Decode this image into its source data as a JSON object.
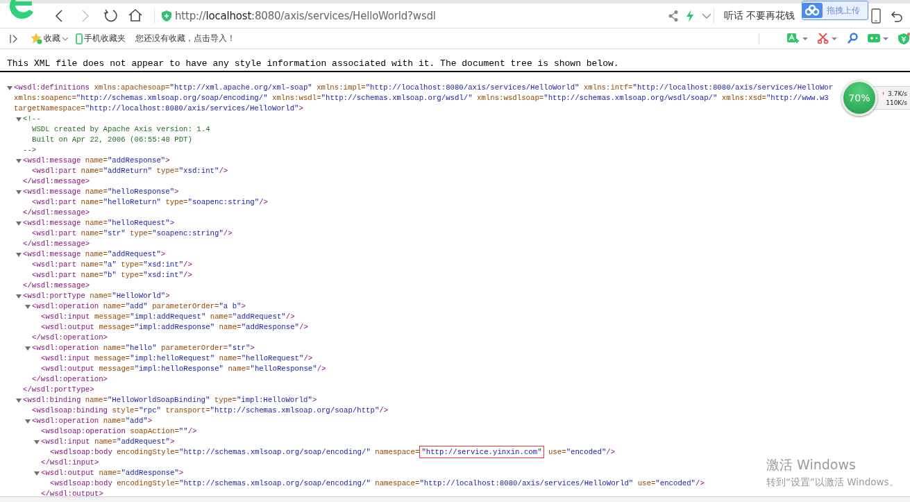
{
  "browser": {
    "nav_buttons": [
      {
        "kind": "back",
        "disabled": false
      },
      {
        "kind": "forward",
        "disabled": true
      },
      {
        "kind": "reload",
        "disabled": false
      },
      {
        "kind": "home",
        "disabled": false
      }
    ],
    "address": {
      "scheme": "http://",
      "host": "localhost",
      "path": ":8080/axis/services/HelloWorld?wsdl"
    },
    "search_text": "听话 不要再花钱",
    "upload_button": "拖拽上传"
  },
  "bookmarks_bar": {
    "favorites": "收藏",
    "mobile_favorites": "手机收藏夹",
    "hint": "您还没有收藏，点击导入！"
  },
  "xml_viewer": {
    "notice": "This XML file does not appear to have any style information associated with it. The document tree is shown below.",
    "tree": [
      {
        "expanded": true,
        "open": [
          [
            {
              "kind": "tag",
              "text": "<wsdl:definitions"
            },
            {
              "kind": "attr",
              "text": " xmlns:apachesoap="
            },
            {
              "kind": "value",
              "text": "\"http://xml.apache.org/xml-soap\""
            },
            {
              "kind": "attr",
              "text": " xmlns:impl="
            },
            {
              "kind": "value",
              "text": "\"http://localhost:8080/axis/services/HelloWorld\""
            },
            {
              "kind": "attr",
              "text": " xmlns:intf="
            },
            {
              "kind": "value",
              "text": "\"http://localhost:8080/axis/services/HelloWor"
            }
          ],
          [
            {
              "kind": "attr",
              "text": "xmlns:soapenc="
            },
            {
              "kind": "value",
              "text": "\"http://schemas.xmlsoap.org/soap/encoding/\""
            },
            {
              "kind": "attr",
              "text": " xmlns:wsdl="
            },
            {
              "kind": "value",
              "text": "\"http://schemas.xmlsoap.org/wsdl/\""
            },
            {
              "kind": "attr",
              "text": " xmlns:wsdlsoap="
            },
            {
              "kind": "value",
              "text": "\"http://schemas.xmlsoap.org/wsdl/soap/\""
            },
            {
              "kind": "attr",
              "text": " xmlns:xsd="
            },
            {
              "kind": "value",
              "text": "\"http://www.w3"
            }
          ],
          [
            {
              "kind": "attr",
              "text": "targetNamespace="
            },
            {
              "kind": "value",
              "text": "\"http://localhost:8080/axis/services/HelloWorld\""
            },
            {
              "kind": "tag",
              "text": ">"
            }
          ]
        ],
        "children": [
          {
            "expanded": true,
            "open": [
              [
                {
                  "kind": "comment",
                  "text": "<!--"
                }
              ]
            ],
            "children": [
              {
                "line": [
                  {
                    "kind": "comment",
                    "text": "WSDL created by Apache Axis version: 1.4"
                  }
                ]
              },
              {
                "line": [
                  {
                    "kind": "comment",
                    "text": "Built on Apr 22, 2006 (06:55:48 PDT)"
                  }
                ]
              }
            ],
            "close": [
              {
                "kind": "comment",
                "text": "-->"
              }
            ]
          },
          {
            "expanded": true,
            "open": [
              [
                {
                  "kind": "tag",
                  "text": "<wsdl:message"
                },
                {
                  "kind": "attr",
                  "text": " name="
                },
                {
                  "kind": "value",
                  "text": "\"addResponse\""
                },
                {
                  "kind": "tag",
                  "text": ">"
                }
              ]
            ],
            "children": [
              {
                "line": [
                  {
                    "kind": "tag",
                    "text": "<wsdl:part"
                  },
                  {
                    "kind": "attr",
                    "text": " name="
                  },
                  {
                    "kind": "value",
                    "text": "\"addReturn\""
                  },
                  {
                    "kind": "attr",
                    "text": " type="
                  },
                  {
                    "kind": "value",
                    "text": "\"xsd:int\""
                  },
                  {
                    "kind": "tag",
                    "text": "/>"
                  }
                ]
              }
            ],
            "close": [
              {
                "kind": "tag",
                "text": "</wsdl:message>"
              }
            ]
          },
          {
            "expanded": true,
            "open": [
              [
                {
                  "kind": "tag",
                  "text": "<wsdl:message"
                },
                {
                  "kind": "attr",
                  "text": " name="
                },
                {
                  "kind": "value",
                  "text": "\"helloResponse\""
                },
                {
                  "kind": "tag",
                  "text": ">"
                }
              ]
            ],
            "children": [
              {
                "line": [
                  {
                    "kind": "tag",
                    "text": "<wsdl:part"
                  },
                  {
                    "kind": "attr",
                    "text": " name="
                  },
                  {
                    "kind": "value",
                    "text": "\"helloReturn\""
                  },
                  {
                    "kind": "attr",
                    "text": " type="
                  },
                  {
                    "kind": "value",
                    "text": "\"soapenc:string\""
                  },
                  {
                    "kind": "tag",
                    "text": "/>"
                  }
                ]
              }
            ],
            "close": [
              {
                "kind": "tag",
                "text": "</wsdl:message>"
              }
            ]
          },
          {
            "expanded": true,
            "open": [
              [
                {
                  "kind": "tag",
                  "text": "<wsdl:message"
                },
                {
                  "kind": "attr",
                  "text": " name="
                },
                {
                  "kind": "value",
                  "text": "\"helloRequest\""
                },
                {
                  "kind": "tag",
                  "text": ">"
                }
              ]
            ],
            "children": [
              {
                "line": [
                  {
                    "kind": "tag",
                    "text": "<wsdl:part"
                  },
                  {
                    "kind": "attr",
                    "text": " name="
                  },
                  {
                    "kind": "value",
                    "text": "\"str\""
                  },
                  {
                    "kind": "attr",
                    "text": " type="
                  },
                  {
                    "kind": "value",
                    "text": "\"soapenc:string\""
                  },
                  {
                    "kind": "tag",
                    "text": "/>"
                  }
                ]
              }
            ],
            "close": [
              {
                "kind": "tag",
                "text": "</wsdl:message>"
              }
            ]
          },
          {
            "expanded": true,
            "open": [
              [
                {
                  "kind": "tag",
                  "text": "<wsdl:message"
                },
                {
                  "kind": "attr",
                  "text": " name="
                },
                {
                  "kind": "value",
                  "text": "\"addRequest\""
                },
                {
                  "kind": "tag",
                  "text": ">"
                }
              ]
            ],
            "children": [
              {
                "line": [
                  {
                    "kind": "tag",
                    "text": "<wsdl:part"
                  },
                  {
                    "kind": "attr",
                    "text": " name="
                  },
                  {
                    "kind": "value",
                    "text": "\"a\""
                  },
                  {
                    "kind": "attr",
                    "text": " type="
                  },
                  {
                    "kind": "value",
                    "text": "\"xsd:int\""
                  },
                  {
                    "kind": "tag",
                    "text": "/>"
                  }
                ]
              },
              {
                "line": [
                  {
                    "kind": "tag",
                    "text": "<wsdl:part"
                  },
                  {
                    "kind": "attr",
                    "text": " name="
                  },
                  {
                    "kind": "value",
                    "text": "\"b\""
                  },
                  {
                    "kind": "attr",
                    "text": " type="
                  },
                  {
                    "kind": "value",
                    "text": "\"xsd:int\""
                  },
                  {
                    "kind": "tag",
                    "text": "/>"
                  }
                ]
              }
            ],
            "close": [
              {
                "kind": "tag",
                "text": "</wsdl:message>"
              }
            ]
          },
          {
            "expanded": true,
            "open": [
              [
                {
                  "kind": "tag",
                  "text": "<wsdl:portType"
                },
                {
                  "kind": "attr",
                  "text": " name="
                },
                {
                  "kind": "value",
                  "text": "\"HelloWorld\""
                },
                {
                  "kind": "tag",
                  "text": ">"
                }
              ]
            ],
            "children": [
              {
                "expanded": true,
                "open": [
                  [
                    {
                      "kind": "tag",
                      "text": "<wsdl:operation"
                    },
                    {
                      "kind": "attr",
                      "text": " name="
                    },
                    {
                      "kind": "value",
                      "text": "\"add\""
                    },
                    {
                      "kind": "attr",
                      "text": " parameterOrder="
                    },
                    {
                      "kind": "value",
                      "text": "\"a b\""
                    },
                    {
                      "kind": "tag",
                      "text": ">"
                    }
                  ]
                ],
                "children": [
                  {
                    "line": [
                      {
                        "kind": "tag",
                        "text": "<wsdl:input"
                      },
                      {
                        "kind": "attr",
                        "text": " message="
                      },
                      {
                        "kind": "value",
                        "text": "\"impl:addRequest\""
                      },
                      {
                        "kind": "attr",
                        "text": " name="
                      },
                      {
                        "kind": "value",
                        "text": "\"addRequest\""
                      },
                      {
                        "kind": "tag",
                        "text": "/>"
                      }
                    ]
                  },
                  {
                    "line": [
                      {
                        "kind": "tag",
                        "text": "<wsdl:output"
                      },
                      {
                        "kind": "attr",
                        "text": " message="
                      },
                      {
                        "kind": "value",
                        "text": "\"impl:addResponse\""
                      },
                      {
                        "kind": "attr",
                        "text": " name="
                      },
                      {
                        "kind": "value",
                        "text": "\"addResponse\""
                      },
                      {
                        "kind": "tag",
                        "text": "/>"
                      }
                    ]
                  }
                ],
                "close": [
                  {
                    "kind": "tag",
                    "text": "</wsdl:operation>"
                  }
                ]
              },
              {
                "expanded": true,
                "open": [
                  [
                    {
                      "kind": "tag",
                      "text": "<wsdl:operation"
                    },
                    {
                      "kind": "attr",
                      "text": " name="
                    },
                    {
                      "kind": "value",
                      "text": "\"hello\""
                    },
                    {
                      "kind": "attr",
                      "text": " parameterOrder="
                    },
                    {
                      "kind": "value",
                      "text": "\"str\""
                    },
                    {
                      "kind": "tag",
                      "text": ">"
                    }
                  ]
                ],
                "children": [
                  {
                    "line": [
                      {
                        "kind": "tag",
                        "text": "<wsdl:input"
                      },
                      {
                        "kind": "attr",
                        "text": " message="
                      },
                      {
                        "kind": "value",
                        "text": "\"impl:helloRequest\""
                      },
                      {
                        "kind": "attr",
                        "text": " name="
                      },
                      {
                        "kind": "value",
                        "text": "\"helloRequest\""
                      },
                      {
                        "kind": "tag",
                        "text": "/>"
                      }
                    ]
                  },
                  {
                    "line": [
                      {
                        "kind": "tag",
                        "text": "<wsdl:output"
                      },
                      {
                        "kind": "attr",
                        "text": " message="
                      },
                      {
                        "kind": "value",
                        "text": "\"impl:helloResponse\""
                      },
                      {
                        "kind": "attr",
                        "text": " name="
                      },
                      {
                        "kind": "value",
                        "text": "\"helloResponse\""
                      },
                      {
                        "kind": "tag",
                        "text": "/>"
                      }
                    ]
                  }
                ],
                "close": [
                  {
                    "kind": "tag",
                    "text": "</wsdl:operation>"
                  }
                ]
              }
            ],
            "close": [
              {
                "kind": "tag",
                "text": "</wsdl:portType>"
              }
            ]
          },
          {
            "expanded": true,
            "open": [
              [
                {
                  "kind": "tag",
                  "text": "<wsdl:binding"
                },
                {
                  "kind": "attr",
                  "text": " name="
                },
                {
                  "kind": "value",
                  "text": "\"HelloWorldSoapBinding\""
                },
                {
                  "kind": "attr",
                  "text": " type="
                },
                {
                  "kind": "value",
                  "text": "\"impl:HelloWorld\""
                },
                {
                  "kind": "tag",
                  "text": ">"
                }
              ]
            ],
            "children": [
              {
                "line": [
                  {
                    "kind": "tag",
                    "text": "<wsdlsoap:binding"
                  },
                  {
                    "kind": "attr",
                    "text": " style="
                  },
                  {
                    "kind": "value",
                    "text": "\"rpc\""
                  },
                  {
                    "kind": "attr",
                    "text": " transport="
                  },
                  {
                    "kind": "value",
                    "text": "\"http://schemas.xmlsoap.org/soap/http\""
                  },
                  {
                    "kind": "tag",
                    "text": "/>"
                  }
                ]
              },
              {
                "expanded": true,
                "open": [
                  [
                    {
                      "kind": "tag",
                      "text": "<wsdl:operation"
                    },
                    {
                      "kind": "attr",
                      "text": " name="
                    },
                    {
                      "kind": "value",
                      "text": "\"add\""
                    },
                    {
                      "kind": "tag",
                      "text": ">"
                    }
                  ]
                ],
                "children": [
                  {
                    "line": [
                      {
                        "kind": "tag",
                        "text": "<wsdlsoap:operation"
                      },
                      {
                        "kind": "attr",
                        "text": " soapAction="
                      },
                      {
                        "kind": "value",
                        "text": "\"\""
                      },
                      {
                        "kind": "tag",
                        "text": "/>"
                      }
                    ]
                  },
                  {
                    "expanded": true,
                    "open": [
                      [
                        {
                          "kind": "tag",
                          "text": "<wsdl:input"
                        },
                        {
                          "kind": "attr",
                          "text": " name="
                        },
                        {
                          "kind": "value",
                          "text": "\"addRequest\""
                        },
                        {
                          "kind": "tag",
                          "text": ">"
                        }
                      ]
                    ],
                    "children": [
                      {
                        "line": [
                          {
                            "kind": "tag",
                            "text": "<wsdlsoap:body"
                          },
                          {
                            "kind": "attr",
                            "text": " encodingStyle="
                          },
                          {
                            "kind": "value",
                            "text": "\"http://schemas.xmlsoap.org/soap/encoding/\""
                          },
                          {
                            "kind": "attr",
                            "text": " namespace="
                          },
                          {
                            "kind": "boxed_value",
                            "text": "\"http://service.yinxin.com\""
                          },
                          {
                            "kind": "attr",
                            "text": " use="
                          },
                          {
                            "kind": "value",
                            "text": "\"encoded\""
                          },
                          {
                            "kind": "tag",
                            "text": "/>"
                          }
                        ]
                      }
                    ],
                    "close": [
                      {
                        "kind": "tag",
                        "text": "</wsdl:input>"
                      }
                    ]
                  },
                  {
                    "expanded": true,
                    "open": [
                      [
                        {
                          "kind": "tag",
                          "text": "<wsdl:output"
                        },
                        {
                          "kind": "attr",
                          "text": " name="
                        },
                        {
                          "kind": "value",
                          "text": "\"addResponse\""
                        },
                        {
                          "kind": "tag",
                          "text": ">"
                        }
                      ]
                    ],
                    "children": [
                      {
                        "line": [
                          {
                            "kind": "tag",
                            "text": "<wsdlsoap:body"
                          },
                          {
                            "kind": "attr",
                            "text": " encodingStyle="
                          },
                          {
                            "kind": "value",
                            "text": "\"http://schemas.xmlsoap.org/soap/encoding/\""
                          },
                          {
                            "kind": "attr",
                            "text": " namespace="
                          },
                          {
                            "kind": "value",
                            "text": "\"http://localhost:8080/axis/services/HelloWorld\""
                          },
                          {
                            "kind": "attr",
                            "text": " use="
                          },
                          {
                            "kind": "value",
                            "text": "\"encoded\""
                          },
                          {
                            "kind": "tag",
                            "text": "/>"
                          }
                        ]
                      }
                    ],
                    "close": [
                      {
                        "kind": "tag",
                        "text": "</wsdl:output>"
                      }
                    ]
                  }
                ]
              }
            ]
          }
        ]
      }
    ]
  },
  "speed_widget": {
    "percent": "70%",
    "upload": "3.7K/s",
    "download": "110K/s"
  },
  "windows_activation": {
    "title": "激活 Windows",
    "subtitle": "转到“设置”以激活 Windows。"
  }
}
